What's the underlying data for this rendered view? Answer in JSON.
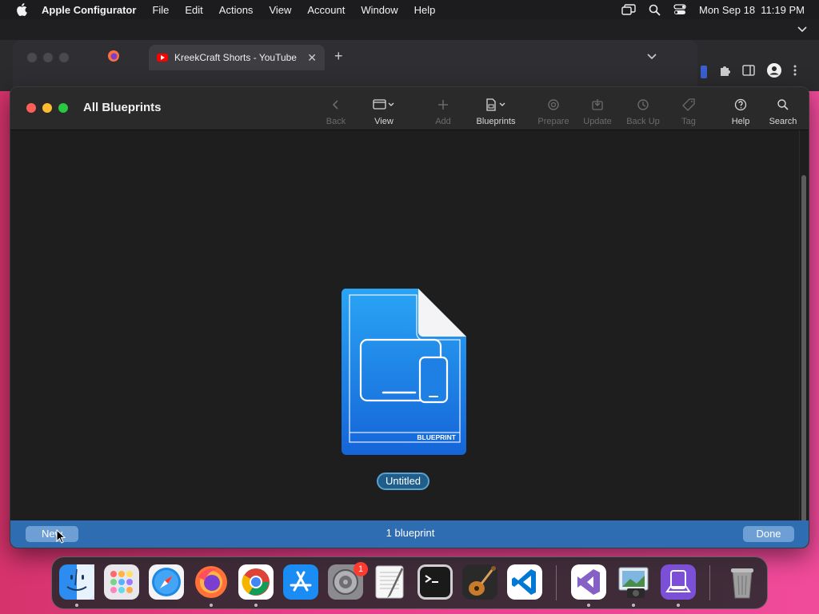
{
  "menubar": {
    "app_name": "Apple Configurator",
    "items": [
      "File",
      "Edit",
      "Actions",
      "View",
      "Account",
      "Window",
      "Help"
    ],
    "clock": "Mon Sep 18  11:19 PM"
  },
  "browser": {
    "active_tab_title": "KreekCraft Shorts - YouTube",
    "close_symbol": "✕",
    "new_tab_symbol": "+"
  },
  "window": {
    "title": "All Blueprints",
    "toolbar": [
      {
        "label": "Back",
        "icon": "chevron-left-icon",
        "enabled": false
      },
      {
        "label": "View",
        "icon": "view-window-icon",
        "enabled": true
      },
      {
        "label": "Add",
        "icon": "plus-icon",
        "enabled": false
      },
      {
        "label": "Blueprints",
        "icon": "blueprints-icon",
        "enabled": true
      },
      {
        "label": "Prepare",
        "icon": "prepare-icon",
        "enabled": false
      },
      {
        "label": "Update",
        "icon": "update-icon",
        "enabled": false
      },
      {
        "label": "Back Up",
        "icon": "backup-icon",
        "enabled": false
      },
      {
        "label": "Tag",
        "icon": "tag-icon",
        "enabled": false
      },
      {
        "label": "Help",
        "icon": "help-icon",
        "enabled": true
      },
      {
        "label": "Search",
        "icon": "search-icon",
        "enabled": true
      }
    ],
    "blueprint": {
      "name": "Untitled",
      "icon_label": "BLUEPRINT"
    },
    "bottom_bar": {
      "new_label": "New",
      "count": "1 blueprint",
      "done_label": "Done"
    }
  },
  "dock": {
    "apps": [
      {
        "name": "Finder",
        "icon": "finder-icon",
        "color": "#2d8cf0",
        "running": true
      },
      {
        "name": "Launchpad",
        "icon": "launchpad-icon",
        "color": "#8e8e93",
        "running": false
      },
      {
        "name": "Safari",
        "icon": "safari-icon",
        "color": "#1e88e5",
        "running": false
      },
      {
        "name": "Firefox",
        "icon": "firefox-icon",
        "color": "#ff7139",
        "running": true
      },
      {
        "name": "Chrome",
        "icon": "chrome-icon",
        "color": "#ffffff",
        "running": true
      },
      {
        "name": "App Store",
        "icon": "app-store-icon",
        "color": "#1c8cf5",
        "running": false
      },
      {
        "name": "System Settings",
        "icon": "system-settings-icon",
        "color": "#8a8a8f",
        "running": false,
        "badge": "1"
      },
      {
        "name": "TextEdit",
        "icon": "textedit-icon",
        "color": "#f2f2f2",
        "running": false
      },
      {
        "name": "Terminal",
        "icon": "terminal-icon",
        "color": "#1a1a1a",
        "running": false
      },
      {
        "name": "GarageBand",
        "icon": "garageband-icon",
        "color": "#7a4a1e",
        "running": false
      },
      {
        "name": "Visual Studio Code",
        "icon": "vscode-icon",
        "color": "#ffffff",
        "running": false
      },
      {
        "name": "Visual Studio",
        "icon": "visual-studio-icon",
        "color": "#ffffff",
        "running": true
      },
      {
        "name": "Preview",
        "icon": "preview-icon",
        "color": "#cfd8dc",
        "running": true
      },
      {
        "name": "Apple Configurator",
        "icon": "apple-configurator-icon",
        "color": "#7b4fd6",
        "running": true
      },
      {
        "name": "Trash",
        "icon": "trash-icon",
        "color": "#9e9e9e",
        "running": false
      }
    ]
  }
}
